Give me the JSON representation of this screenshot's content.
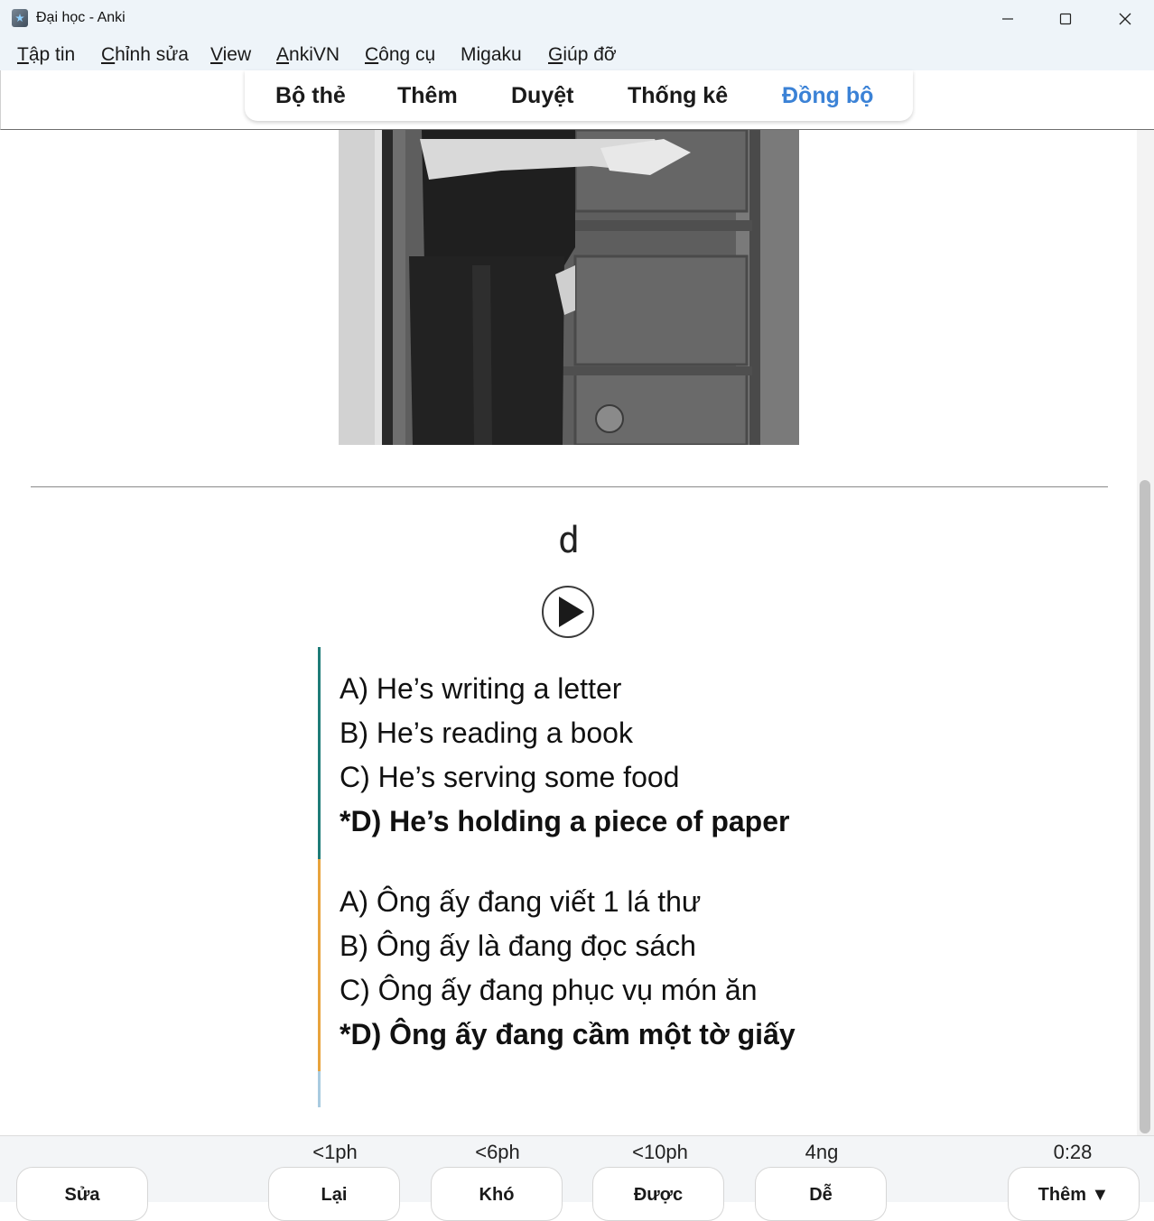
{
  "window": {
    "title": "Đại học - Anki",
    "icon": "anki-app-icon",
    "controls": [
      "minimize-icon",
      "maximize-icon",
      "close-icon"
    ]
  },
  "menu": [
    {
      "label": "Tập tin",
      "ul": "T",
      "rest": "ập tin"
    },
    {
      "label": "Chỉnh sửa",
      "ul": "C",
      "rest": "hỉnh sửa"
    },
    {
      "label": "View",
      "ul": "V",
      "rest": "iew"
    },
    {
      "label": "AnkiVN",
      "ul": "A",
      "rest": "nkiVN"
    },
    {
      "label": "Công cụ",
      "ul": "C",
      "rest": "ông cụ"
    },
    {
      "label": "Migaku",
      "ul": "",
      "rest": "Migaku"
    },
    {
      "label": "Giúp đỡ",
      "ul": "G",
      "rest": "iúp đỡ"
    }
  ],
  "toolbar": {
    "items": [
      "Bộ thẻ",
      "Thêm",
      "Duyệt",
      "Thống kê",
      "Đồng bộ"
    ],
    "active": "Đồng bộ",
    "active_color": "#3b82d6"
  },
  "card": {
    "answer_letter": "d",
    "audio_icon": "play-icon",
    "options_en": [
      "A) He’s writing a letter",
      "B) He’s reading a book",
      "C) He’s serving some food",
      "*D) He’s holding a piece of paper"
    ],
    "options_vi": [
      "A) Ông ấy đang viết 1 lá thư",
      "B) Ông ấy là đang đọc sách",
      "C) Ông ấy đang phục vụ món ăn",
      "*D) Ông ấy đang cầm một tờ giấy"
    ],
    "accent_en": "#1f7c78",
    "accent_vi": "#e8a33d",
    "accent_blank": "#a9cbe0"
  },
  "bottom": {
    "edit_label": "Sửa",
    "more_label": "Thêm ▼",
    "timer": "0:28",
    "answers": [
      {
        "label": "Lại",
        "interval": "<1ph"
      },
      {
        "label": "Khó",
        "interval": "<6ph"
      },
      {
        "label": "Được",
        "interval": "<10ph"
      },
      {
        "label": "Dễ",
        "interval": "4ng"
      }
    ]
  }
}
